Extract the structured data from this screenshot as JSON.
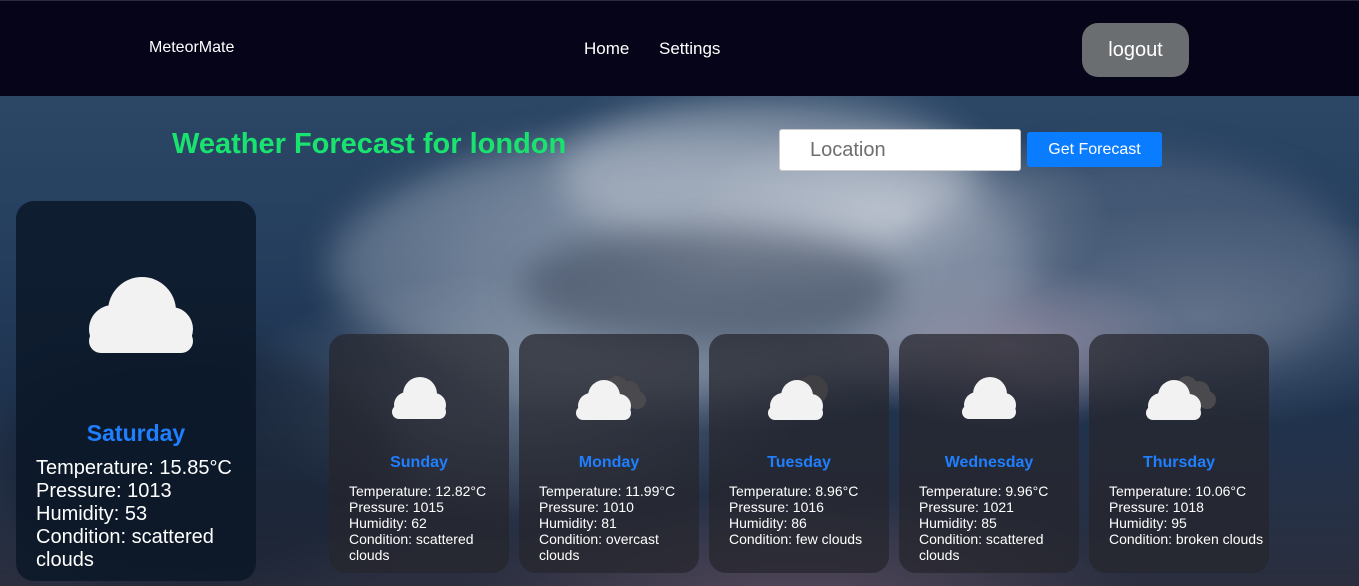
{
  "navbar": {
    "brand": "MeteorMate",
    "links": [
      {
        "label": "Home"
      },
      {
        "label": "Settings"
      }
    ],
    "logout_label": "logout"
  },
  "main": {
    "title": "Weather Forecast for london",
    "search": {
      "placeholder": "Location",
      "value": "",
      "button_label": "Get Forecast"
    }
  },
  "colors": {
    "title": "#19e36f",
    "day_label": "#1f7fff",
    "button": "#0a7cff",
    "logout": "#6b6e70"
  },
  "today": {
    "day": "Saturday",
    "icon": "scattered-clouds-icon",
    "temperature": "Temperature: 15.85°C",
    "pressure": "Pressure: 1013",
    "humidity": "Humidity: 53",
    "condition": "Condition: scattered clouds"
  },
  "forecast": [
    {
      "day": "Sunday",
      "icon": "scattered-clouds-icon",
      "temperature": "Temperature: 12.82°C",
      "pressure": "Pressure: 1015",
      "humidity": "Humidity: 62",
      "condition": "Condition: scattered clouds"
    },
    {
      "day": "Monday",
      "icon": "overcast-clouds-icon",
      "temperature": "Temperature: 11.99°C",
      "pressure": "Pressure: 1010",
      "humidity": "Humidity: 81",
      "condition": "Condition: overcast clouds"
    },
    {
      "day": "Tuesday",
      "icon": "few-clouds-icon",
      "temperature": "Temperature: 8.96°C",
      "pressure": "Pressure: 1016",
      "humidity": "Humidity: 86",
      "condition": "Condition: few clouds"
    },
    {
      "day": "Wednesday",
      "icon": "scattered-clouds-icon",
      "temperature": "Temperature: 9.96°C",
      "pressure": "Pressure: 1021",
      "humidity": "Humidity: 85",
      "condition": "Condition: scattered clouds"
    },
    {
      "day": "Thursday",
      "icon": "broken-clouds-icon",
      "temperature": "Temperature: 10.06°C",
      "pressure": "Pressure: 1018",
      "humidity": "Humidity: 95",
      "condition": "Condition: broken clouds"
    }
  ]
}
